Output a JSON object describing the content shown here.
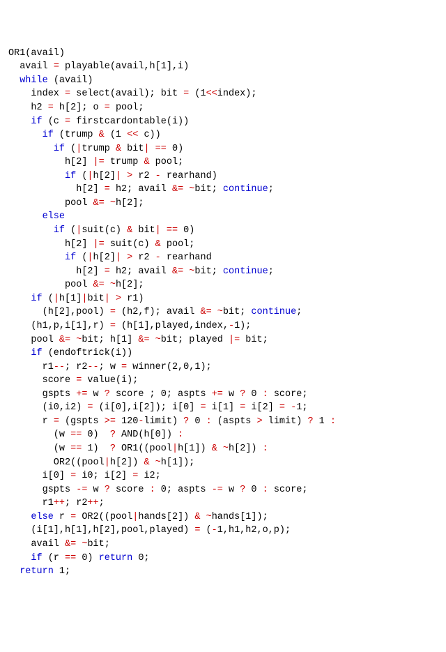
{
  "lines": [
    [
      {
        "t": "OR1(avail)",
        "c": "tok"
      }
    ],
    [
      {
        "t": "  avail ",
        "c": "tok"
      },
      {
        "t": "=",
        "c": "op"
      },
      {
        "t": " playable(avail,h[1],i)",
        "c": "tok"
      }
    ],
    [
      {
        "t": "  ",
        "c": "tok"
      },
      {
        "t": "while",
        "c": "kw"
      },
      {
        "t": " (avail)",
        "c": "tok"
      }
    ],
    [
      {
        "t": "    index ",
        "c": "tok"
      },
      {
        "t": "=",
        "c": "op"
      },
      {
        "t": " select(avail); bit ",
        "c": "tok"
      },
      {
        "t": "=",
        "c": "op"
      },
      {
        "t": " (1",
        "c": "tok"
      },
      {
        "t": "<<",
        "c": "op"
      },
      {
        "t": "index);",
        "c": "tok"
      }
    ],
    [
      {
        "t": "    h2 ",
        "c": "tok"
      },
      {
        "t": "=",
        "c": "op"
      },
      {
        "t": " h[2]; o ",
        "c": "tok"
      },
      {
        "t": "=",
        "c": "op"
      },
      {
        "t": " pool;",
        "c": "tok"
      }
    ],
    [
      {
        "t": "    ",
        "c": "tok"
      },
      {
        "t": "if",
        "c": "kw"
      },
      {
        "t": " (c ",
        "c": "tok"
      },
      {
        "t": "=",
        "c": "op"
      },
      {
        "t": " firstcardontable(i))",
        "c": "tok"
      }
    ],
    [
      {
        "t": "      ",
        "c": "tok"
      },
      {
        "t": "if",
        "c": "kw"
      },
      {
        "t": " (trump ",
        "c": "tok"
      },
      {
        "t": "&",
        "c": "op"
      },
      {
        "t": " (1 ",
        "c": "tok"
      },
      {
        "t": "<<",
        "c": "op"
      },
      {
        "t": " c))",
        "c": "tok"
      }
    ],
    [
      {
        "t": "        ",
        "c": "tok"
      },
      {
        "t": "if",
        "c": "kw"
      },
      {
        "t": " (",
        "c": "tok"
      },
      {
        "t": "|",
        "c": "op"
      },
      {
        "t": "trump ",
        "c": "tok"
      },
      {
        "t": "&",
        "c": "op"
      },
      {
        "t": " bit",
        "c": "tok"
      },
      {
        "t": "|",
        "c": "op"
      },
      {
        "t": " ",
        "c": "tok"
      },
      {
        "t": "==",
        "c": "op"
      },
      {
        "t": " 0)",
        "c": "tok"
      }
    ],
    [
      {
        "t": "          h[2] ",
        "c": "tok"
      },
      {
        "t": "|=",
        "c": "op"
      },
      {
        "t": " trump ",
        "c": "tok"
      },
      {
        "t": "&",
        "c": "op"
      },
      {
        "t": " pool;",
        "c": "tok"
      }
    ],
    [
      {
        "t": "          ",
        "c": "tok"
      },
      {
        "t": "if",
        "c": "kw"
      },
      {
        "t": " (",
        "c": "tok"
      },
      {
        "t": "|",
        "c": "op"
      },
      {
        "t": "h[2]",
        "c": "tok"
      },
      {
        "t": "|",
        "c": "op"
      },
      {
        "t": " ",
        "c": "tok"
      },
      {
        "t": ">",
        "c": "op"
      },
      {
        "t": " r2 ",
        "c": "tok"
      },
      {
        "t": "-",
        "c": "op"
      },
      {
        "t": " rearhand)",
        "c": "tok"
      }
    ],
    [
      {
        "t": "            h[2] ",
        "c": "tok"
      },
      {
        "t": "=",
        "c": "op"
      },
      {
        "t": " h2; avail ",
        "c": "tok"
      },
      {
        "t": "&=",
        "c": "op"
      },
      {
        "t": " ",
        "c": "tok"
      },
      {
        "t": "~",
        "c": "op"
      },
      {
        "t": "bit; ",
        "c": "tok"
      },
      {
        "t": "continue",
        "c": "kw"
      },
      {
        "t": ";",
        "c": "tok"
      }
    ],
    [
      {
        "t": "          pool ",
        "c": "tok"
      },
      {
        "t": "&=",
        "c": "op"
      },
      {
        "t": " ",
        "c": "tok"
      },
      {
        "t": "~",
        "c": "op"
      },
      {
        "t": "h[2];",
        "c": "tok"
      }
    ],
    [
      {
        "t": "      ",
        "c": "tok"
      },
      {
        "t": "else",
        "c": "kw"
      }
    ],
    [
      {
        "t": "        ",
        "c": "tok"
      },
      {
        "t": "if",
        "c": "kw"
      },
      {
        "t": " (",
        "c": "tok"
      },
      {
        "t": "|",
        "c": "op"
      },
      {
        "t": "suit(c) ",
        "c": "tok"
      },
      {
        "t": "&",
        "c": "op"
      },
      {
        "t": " bit",
        "c": "tok"
      },
      {
        "t": "|",
        "c": "op"
      },
      {
        "t": " ",
        "c": "tok"
      },
      {
        "t": "==",
        "c": "op"
      },
      {
        "t": " 0)",
        "c": "tok"
      }
    ],
    [
      {
        "t": "          h[2] ",
        "c": "tok"
      },
      {
        "t": "|=",
        "c": "op"
      },
      {
        "t": " suit(c) ",
        "c": "tok"
      },
      {
        "t": "&",
        "c": "op"
      },
      {
        "t": " pool;",
        "c": "tok"
      }
    ],
    [
      {
        "t": "          ",
        "c": "tok"
      },
      {
        "t": "if",
        "c": "kw"
      },
      {
        "t": " (",
        "c": "tok"
      },
      {
        "t": "|",
        "c": "op"
      },
      {
        "t": "h[2]",
        "c": "tok"
      },
      {
        "t": "|",
        "c": "op"
      },
      {
        "t": " ",
        "c": "tok"
      },
      {
        "t": ">",
        "c": "op"
      },
      {
        "t": " r2 ",
        "c": "tok"
      },
      {
        "t": "-",
        "c": "op"
      },
      {
        "t": " rearhand",
        "c": "tok"
      }
    ],
    [
      {
        "t": "            h[2] ",
        "c": "tok"
      },
      {
        "t": "=",
        "c": "op"
      },
      {
        "t": " h2; avail ",
        "c": "tok"
      },
      {
        "t": "&=",
        "c": "op"
      },
      {
        "t": " ",
        "c": "tok"
      },
      {
        "t": "~",
        "c": "op"
      },
      {
        "t": "bit; ",
        "c": "tok"
      },
      {
        "t": "continue",
        "c": "kw"
      },
      {
        "t": ";",
        "c": "tok"
      }
    ],
    [
      {
        "t": "          pool ",
        "c": "tok"
      },
      {
        "t": "&=",
        "c": "op"
      },
      {
        "t": " ",
        "c": "tok"
      },
      {
        "t": "~",
        "c": "op"
      },
      {
        "t": "h[2];",
        "c": "tok"
      }
    ],
    [
      {
        "t": "    ",
        "c": "tok"
      },
      {
        "t": "if",
        "c": "kw"
      },
      {
        "t": " (",
        "c": "tok"
      },
      {
        "t": "|",
        "c": "op"
      },
      {
        "t": "h[1]",
        "c": "tok"
      },
      {
        "t": "|",
        "c": "op"
      },
      {
        "t": "bit",
        "c": "tok"
      },
      {
        "t": "|",
        "c": "op"
      },
      {
        "t": " ",
        "c": "tok"
      },
      {
        "t": ">",
        "c": "op"
      },
      {
        "t": " r1)",
        "c": "tok"
      }
    ],
    [
      {
        "t": "      (h[2],pool) ",
        "c": "tok"
      },
      {
        "t": "=",
        "c": "op"
      },
      {
        "t": " (h2,f); avail ",
        "c": "tok"
      },
      {
        "t": "&=",
        "c": "op"
      },
      {
        "t": " ",
        "c": "tok"
      },
      {
        "t": "~",
        "c": "op"
      },
      {
        "t": "bit; ",
        "c": "tok"
      },
      {
        "t": "continue",
        "c": "kw"
      },
      {
        "t": ";",
        "c": "tok"
      }
    ],
    [
      {
        "t": "    (h1,p,i[1],r) ",
        "c": "tok"
      },
      {
        "t": "=",
        "c": "op"
      },
      {
        "t": " (h[1],played,index,",
        "c": "tok"
      },
      {
        "t": "-",
        "c": "op"
      },
      {
        "t": "1);",
        "c": "tok"
      }
    ],
    [
      {
        "t": "    pool ",
        "c": "tok"
      },
      {
        "t": "&=",
        "c": "op"
      },
      {
        "t": " ",
        "c": "tok"
      },
      {
        "t": "~",
        "c": "op"
      },
      {
        "t": "bit; h[1] ",
        "c": "tok"
      },
      {
        "t": "&=",
        "c": "op"
      },
      {
        "t": " ",
        "c": "tok"
      },
      {
        "t": "~",
        "c": "op"
      },
      {
        "t": "bit; played ",
        "c": "tok"
      },
      {
        "t": "|=",
        "c": "op"
      },
      {
        "t": " bit;",
        "c": "tok"
      }
    ],
    [
      {
        "t": "    ",
        "c": "tok"
      },
      {
        "t": "if",
        "c": "kw"
      },
      {
        "t": " (endoftrick(i))",
        "c": "tok"
      }
    ],
    [
      {
        "t": "      r1",
        "c": "tok"
      },
      {
        "t": "--",
        "c": "op"
      },
      {
        "t": "; r2",
        "c": "tok"
      },
      {
        "t": "--",
        "c": "op"
      },
      {
        "t": "; w ",
        "c": "tok"
      },
      {
        "t": "=",
        "c": "op"
      },
      {
        "t": " winner(2,0,1);",
        "c": "tok"
      }
    ],
    [
      {
        "t": "      score ",
        "c": "tok"
      },
      {
        "t": "=",
        "c": "op"
      },
      {
        "t": " value(i);",
        "c": "tok"
      }
    ],
    [
      {
        "t": "      gspts ",
        "c": "tok"
      },
      {
        "t": "+=",
        "c": "op"
      },
      {
        "t": " w ",
        "c": "tok"
      },
      {
        "t": "?",
        "c": "op"
      },
      {
        "t": " score ; 0; aspts ",
        "c": "tok"
      },
      {
        "t": "+=",
        "c": "op"
      },
      {
        "t": " w ",
        "c": "tok"
      },
      {
        "t": "?",
        "c": "op"
      },
      {
        "t": " 0 ",
        "c": "tok"
      },
      {
        "t": ":",
        "c": "op"
      },
      {
        "t": " score;",
        "c": "tok"
      }
    ],
    [
      {
        "t": "      (i0,i2) ",
        "c": "tok"
      },
      {
        "t": "=",
        "c": "op"
      },
      {
        "t": " (i[0],i[2]); i[0] ",
        "c": "tok"
      },
      {
        "t": "=",
        "c": "op"
      },
      {
        "t": " i[1] ",
        "c": "tok"
      },
      {
        "t": "=",
        "c": "op"
      },
      {
        "t": " i[2] ",
        "c": "tok"
      },
      {
        "t": "=",
        "c": "op"
      },
      {
        "t": " ",
        "c": "tok"
      },
      {
        "t": "-",
        "c": "op"
      },
      {
        "t": "1;",
        "c": "tok"
      }
    ],
    [
      {
        "t": "      r ",
        "c": "tok"
      },
      {
        "t": "=",
        "c": "op"
      },
      {
        "t": " (gspts ",
        "c": "tok"
      },
      {
        "t": ">=",
        "c": "op"
      },
      {
        "t": " 120",
        "c": "tok"
      },
      {
        "t": "-",
        "c": "op"
      },
      {
        "t": "limit) ",
        "c": "tok"
      },
      {
        "t": "?",
        "c": "op"
      },
      {
        "t": " 0 ",
        "c": "tok"
      },
      {
        "t": ":",
        "c": "op"
      },
      {
        "t": " (aspts ",
        "c": "tok"
      },
      {
        "t": ">",
        "c": "op"
      },
      {
        "t": " limit) ",
        "c": "tok"
      },
      {
        "t": "?",
        "c": "op"
      },
      {
        "t": " 1 ",
        "c": "tok"
      },
      {
        "t": ":",
        "c": "op"
      }
    ],
    [
      {
        "t": "        (w ",
        "c": "tok"
      },
      {
        "t": "==",
        "c": "op"
      },
      {
        "t": " 0)  ",
        "c": "tok"
      },
      {
        "t": "?",
        "c": "op"
      },
      {
        "t": " AND(h[0]) ",
        "c": "tok"
      },
      {
        "t": ":",
        "c": "op"
      }
    ],
    [
      {
        "t": "        (w ",
        "c": "tok"
      },
      {
        "t": "==",
        "c": "op"
      },
      {
        "t": " 1)  ",
        "c": "tok"
      },
      {
        "t": "?",
        "c": "op"
      },
      {
        "t": " OR1((pool",
        "c": "tok"
      },
      {
        "t": "|",
        "c": "op"
      },
      {
        "t": "h[1]) ",
        "c": "tok"
      },
      {
        "t": "&",
        "c": "op"
      },
      {
        "t": " ",
        "c": "tok"
      },
      {
        "t": "~",
        "c": "op"
      },
      {
        "t": "h[2]) ",
        "c": "tok"
      },
      {
        "t": ":",
        "c": "op"
      }
    ],
    [
      {
        "t": "        OR2((pool",
        "c": "tok"
      },
      {
        "t": "|",
        "c": "op"
      },
      {
        "t": "h[2]) ",
        "c": "tok"
      },
      {
        "t": "&",
        "c": "op"
      },
      {
        "t": " ",
        "c": "tok"
      },
      {
        "t": "~",
        "c": "op"
      },
      {
        "t": "h[1]);",
        "c": "tok"
      }
    ],
    [
      {
        "t": "      i[0] ",
        "c": "tok"
      },
      {
        "t": "=",
        "c": "op"
      },
      {
        "t": " i0; i[2] ",
        "c": "tok"
      },
      {
        "t": "=",
        "c": "op"
      },
      {
        "t": " i2;",
        "c": "tok"
      }
    ],
    [
      {
        "t": "      gspts ",
        "c": "tok"
      },
      {
        "t": "-=",
        "c": "op"
      },
      {
        "t": " w ",
        "c": "tok"
      },
      {
        "t": "?",
        "c": "op"
      },
      {
        "t": " score ",
        "c": "tok"
      },
      {
        "t": ":",
        "c": "op"
      },
      {
        "t": " 0; aspts ",
        "c": "tok"
      },
      {
        "t": "-=",
        "c": "op"
      },
      {
        "t": " w ",
        "c": "tok"
      },
      {
        "t": "?",
        "c": "op"
      },
      {
        "t": " 0 ",
        "c": "tok"
      },
      {
        "t": ":",
        "c": "op"
      },
      {
        "t": " score;",
        "c": "tok"
      }
    ],
    [
      {
        "t": "      r1",
        "c": "tok"
      },
      {
        "t": "++",
        "c": "op"
      },
      {
        "t": "; r2",
        "c": "tok"
      },
      {
        "t": "++",
        "c": "op"
      },
      {
        "t": ";",
        "c": "tok"
      }
    ],
    [
      {
        "t": "    ",
        "c": "tok"
      },
      {
        "t": "else",
        "c": "kw"
      },
      {
        "t": " r ",
        "c": "tok"
      },
      {
        "t": "=",
        "c": "op"
      },
      {
        "t": " OR2((pool",
        "c": "tok"
      },
      {
        "t": "|",
        "c": "op"
      },
      {
        "t": "hands[2]) ",
        "c": "tok"
      },
      {
        "t": "&",
        "c": "op"
      },
      {
        "t": " ",
        "c": "tok"
      },
      {
        "t": "~",
        "c": "op"
      },
      {
        "t": "hands[1]);",
        "c": "tok"
      }
    ],
    [
      {
        "t": "    (i[1],h[1],h[2],pool,played) ",
        "c": "tok"
      },
      {
        "t": "=",
        "c": "op"
      },
      {
        "t": " (",
        "c": "tok"
      },
      {
        "t": "-",
        "c": "op"
      },
      {
        "t": "1,h1,h2,o,p);",
        "c": "tok"
      }
    ],
    [
      {
        "t": "    avail ",
        "c": "tok"
      },
      {
        "t": "&=",
        "c": "op"
      },
      {
        "t": " ",
        "c": "tok"
      },
      {
        "t": "~",
        "c": "op"
      },
      {
        "t": "bit;",
        "c": "tok"
      }
    ],
    [
      {
        "t": "    ",
        "c": "tok"
      },
      {
        "t": "if",
        "c": "kw"
      },
      {
        "t": " (r ",
        "c": "tok"
      },
      {
        "t": "==",
        "c": "op"
      },
      {
        "t": " 0) ",
        "c": "tok"
      },
      {
        "t": "return",
        "c": "kw"
      },
      {
        "t": " 0;",
        "c": "tok"
      }
    ],
    [
      {
        "t": "  ",
        "c": "tok"
      },
      {
        "t": "return",
        "c": "kw"
      },
      {
        "t": " 1;",
        "c": "tok"
      }
    ]
  ]
}
